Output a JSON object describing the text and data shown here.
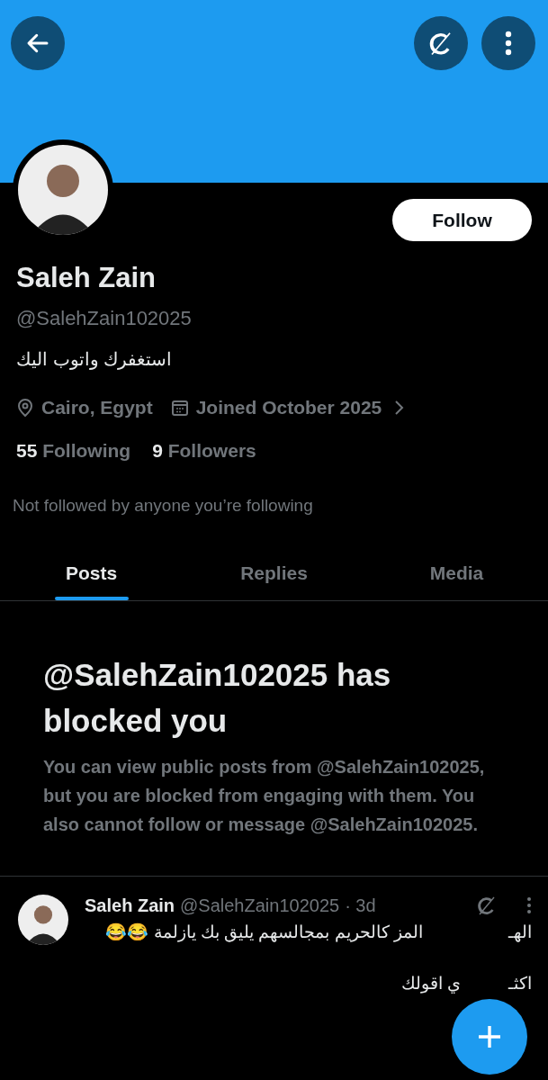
{
  "profile": {
    "name": "Saleh Zain",
    "handle": "@SalehZain102025",
    "bio": "استغفرك واتوب اليك",
    "location": "Cairo, Egypt",
    "joined": "Joined October 2025",
    "following_count": "55",
    "following_label": "Following",
    "followers_count": "9",
    "followers_label": "Followers",
    "followed_by": "Not followed by anyone you’re following",
    "follow_button": "Follow"
  },
  "tabs": [
    {
      "label": "Posts",
      "selected": true
    },
    {
      "label": "Replies",
      "selected": false
    },
    {
      "label": "Media",
      "selected": false
    }
  ],
  "blocked_notice": {
    "title": "@SalehZain102025 has blocked you",
    "body": "You can view public posts from @SalehZain102025, but you are blocked from engaging with them. You also cannot follow or message @SalehZain102025."
  },
  "post": {
    "name": "Saleh Zain",
    "handle": "@SalehZain102025",
    "time": "· 3d",
    "lines": [
      "الهـ                  المز كالحريم بمجالسهم يليق بك يازلمة 😂😂",
      "اكثـ          ي اقولك"
    ]
  }
}
